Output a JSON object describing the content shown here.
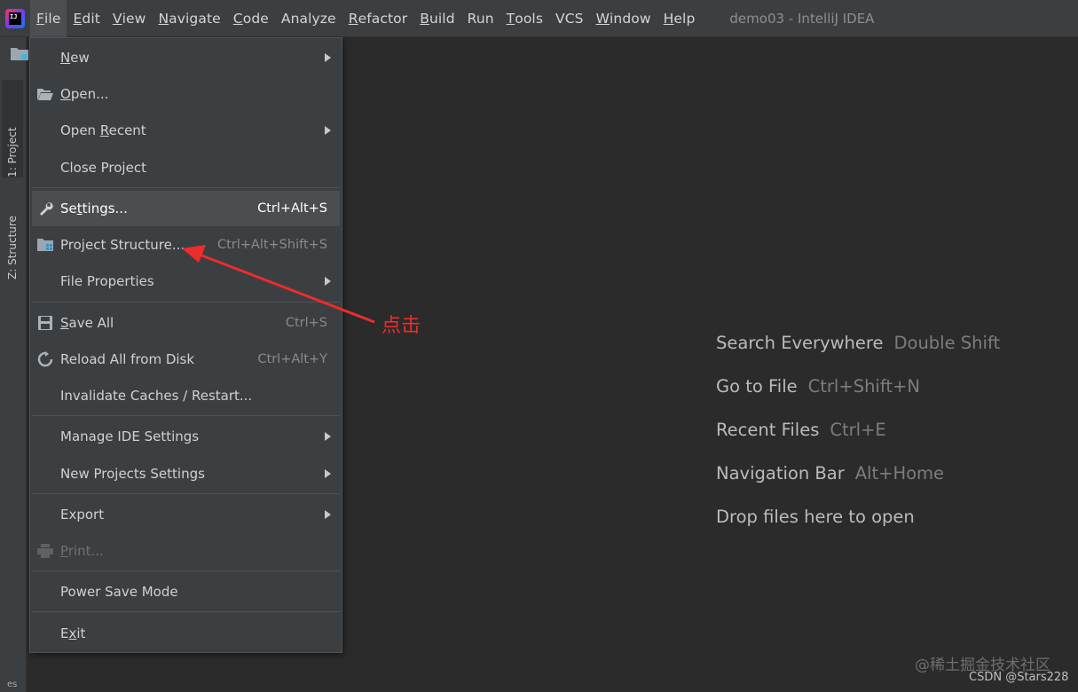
{
  "menubar": {
    "items": [
      {
        "label": "File",
        "mnemonic": "F",
        "rest": "ile",
        "active": true
      },
      {
        "label": "Edit",
        "mnemonic": "E",
        "rest": "dit"
      },
      {
        "label": "View",
        "mnemonic": "V",
        "rest": "iew"
      },
      {
        "label": "Navigate",
        "mnemonic": "N",
        "rest": "avigate"
      },
      {
        "label": "Code",
        "mnemonic": "C",
        "rest": "ode"
      },
      {
        "label": "Analyze",
        "mnemonic": "",
        "rest": "Analyze"
      },
      {
        "label": "Refactor",
        "mnemonic": "R",
        "rest": "efactor"
      },
      {
        "label": "Build",
        "mnemonic": "B",
        "rest": "uild"
      },
      {
        "label": "Run",
        "mnemonic": "",
        "rest": "Run"
      },
      {
        "label": "Tools",
        "mnemonic": "T",
        "rest": "ools"
      },
      {
        "label": "VCS",
        "mnemonic": "",
        "rest": "VCS"
      },
      {
        "label": "Window",
        "mnemonic": "W",
        "rest": "indow"
      },
      {
        "label": "Help",
        "mnemonic": "H",
        "rest": "elp"
      }
    ],
    "window_title": "demo03 - IntelliJ IDEA"
  },
  "toolstrip": {
    "project_tab": "1: Project",
    "structure_tab": "Z: Structure",
    "bottom_label": "es"
  },
  "file_menu": {
    "new": {
      "pre": "",
      "u": "N",
      "post": "ew"
    },
    "open": {
      "pre": "",
      "u": "O",
      "post": "pen..."
    },
    "open_recent": {
      "pre": "Open ",
      "u": "R",
      "post": "ecent"
    },
    "close_project": {
      "pre": "Close Project",
      "u": "",
      "post": ""
    },
    "settings": {
      "pre": "Se",
      "u": "t",
      "post": "tings...",
      "shortcut": "Ctrl+Alt+S"
    },
    "project_structure": {
      "pre": "Project Structure...",
      "u": "",
      "post": "",
      "shortcut": "Ctrl+Alt+Shift+S"
    },
    "file_properties": {
      "pre": "File Properties",
      "u": "",
      "post": ""
    },
    "save_all": {
      "pre": "",
      "u": "S",
      "post": "ave All",
      "shortcut": "Ctrl+S"
    },
    "reload": {
      "pre": "Reload All from Disk",
      "u": "",
      "post": "",
      "shortcut": "Ctrl+Alt+Y"
    },
    "invalidate": {
      "pre": "Invalidate Caches / Restart...",
      "u": "",
      "post": ""
    },
    "manage_ide": {
      "pre": "Manage IDE Settings",
      "u": "",
      "post": ""
    },
    "new_projects": {
      "pre": "New Projects Settings",
      "u": "",
      "post": ""
    },
    "export": {
      "pre": "Export",
      "u": "",
      "post": ""
    },
    "print": {
      "pre": "",
      "u": "P",
      "post": "rint..."
    },
    "power_save": {
      "pre": "Power Save Mode",
      "u": "",
      "post": ""
    },
    "exit": {
      "pre": "E",
      "u": "x",
      "post": "it"
    }
  },
  "hints": [
    {
      "label": "Search Everywhere",
      "key": "Double Shift"
    },
    {
      "label": "Go to File",
      "key": "Ctrl+Shift+N"
    },
    {
      "label": "Recent Files",
      "key": "Ctrl+E"
    },
    {
      "label": "Navigation Bar",
      "key": "Alt+Home"
    },
    {
      "label": "Drop files here to open",
      "key": ""
    }
  ],
  "annotation": {
    "text": "点击",
    "color": "#ee2c2c"
  },
  "watermark": {
    "line1": "@稀土掘金技术社区",
    "line2": "CSDN @Stars228"
  },
  "colors": {
    "background": "#2b2b2b",
    "menubar": "#3c3f41",
    "highlight": "#4b4e50",
    "accent": "#3592c4"
  }
}
